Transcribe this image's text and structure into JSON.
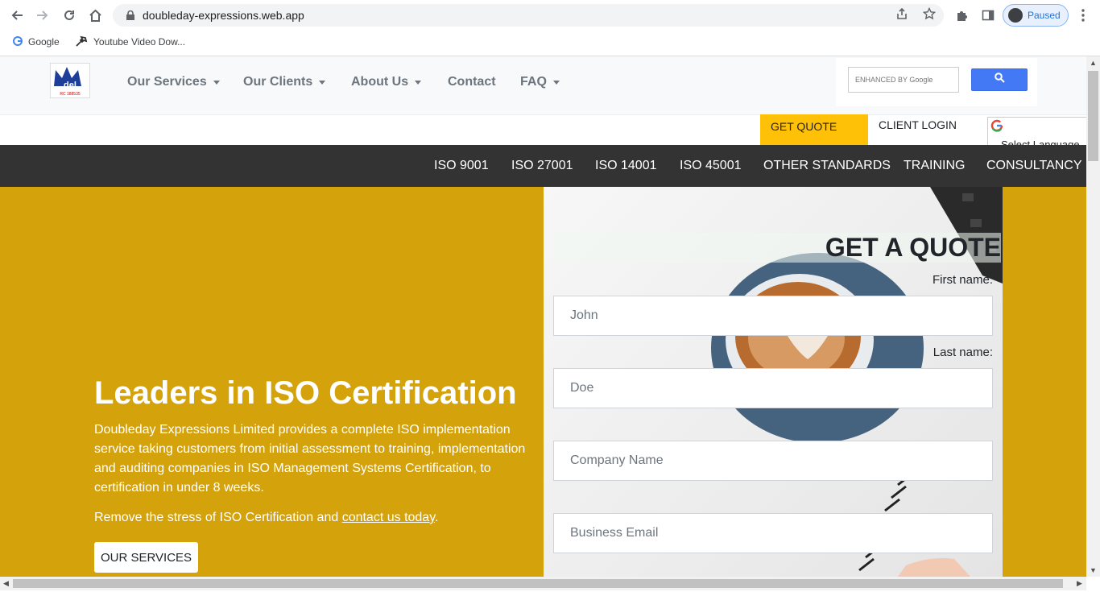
{
  "browser": {
    "url": "doubleday-expressions.web.app",
    "profile_status": "Paused",
    "bookmarks": [
      {
        "label": "Google",
        "icon": "google-icon"
      },
      {
        "label": "Youtube Video Dow...",
        "icon": "hammer-icon"
      }
    ]
  },
  "header": {
    "logo_text": "del",
    "logo_sub": "RC 188535",
    "menu": [
      {
        "label": "Our Services",
        "dropdown": true
      },
      {
        "label": "Our Clients",
        "dropdown": true
      },
      {
        "label": "About Us",
        "dropdown": true
      },
      {
        "label": "Contact",
        "dropdown": false
      },
      {
        "label": "FAQ",
        "dropdown": true
      }
    ],
    "search_placeholder": "ENHANCED BY Google"
  },
  "top_strip": {
    "get_quote": "GET QUOTE",
    "client_login": "CLIENT LOGIN",
    "language": "Select Language"
  },
  "dark_nav": [
    "ISO 9001",
    "ISO 27001",
    "ISO 14001",
    "ISO 45001",
    "OTHER STANDARDS",
    "TRAINING",
    "CONSULTANCY"
  ],
  "hero": {
    "title": "Leaders in ISO Certification",
    "description": "Doubleday Expressions Limited provides a complete ISO implementation service taking customers from initial assessment to training, implementation and auditing companies in ISO Management Systems Certification, to certification in under 8 weeks.",
    "cta_prefix": "Remove the stress of ISO Certification and ",
    "cta_link": "contact us today",
    "cta_suffix": ".",
    "button": "OUR SERVICES"
  },
  "quote_form": {
    "title": "GET A QUOTE",
    "first_name_label": "First name:",
    "first_name_placeholder": "John",
    "last_name_label": "Last name:",
    "last_name_placeholder": "Doe",
    "company_placeholder": "Company Name",
    "email_placeholder": "Business Email"
  },
  "colors": {
    "hero_gold": "#d4a20b",
    "quote_yellow": "#ffc107",
    "dark_nav": "#333333",
    "search_blue": "#4479f5"
  }
}
